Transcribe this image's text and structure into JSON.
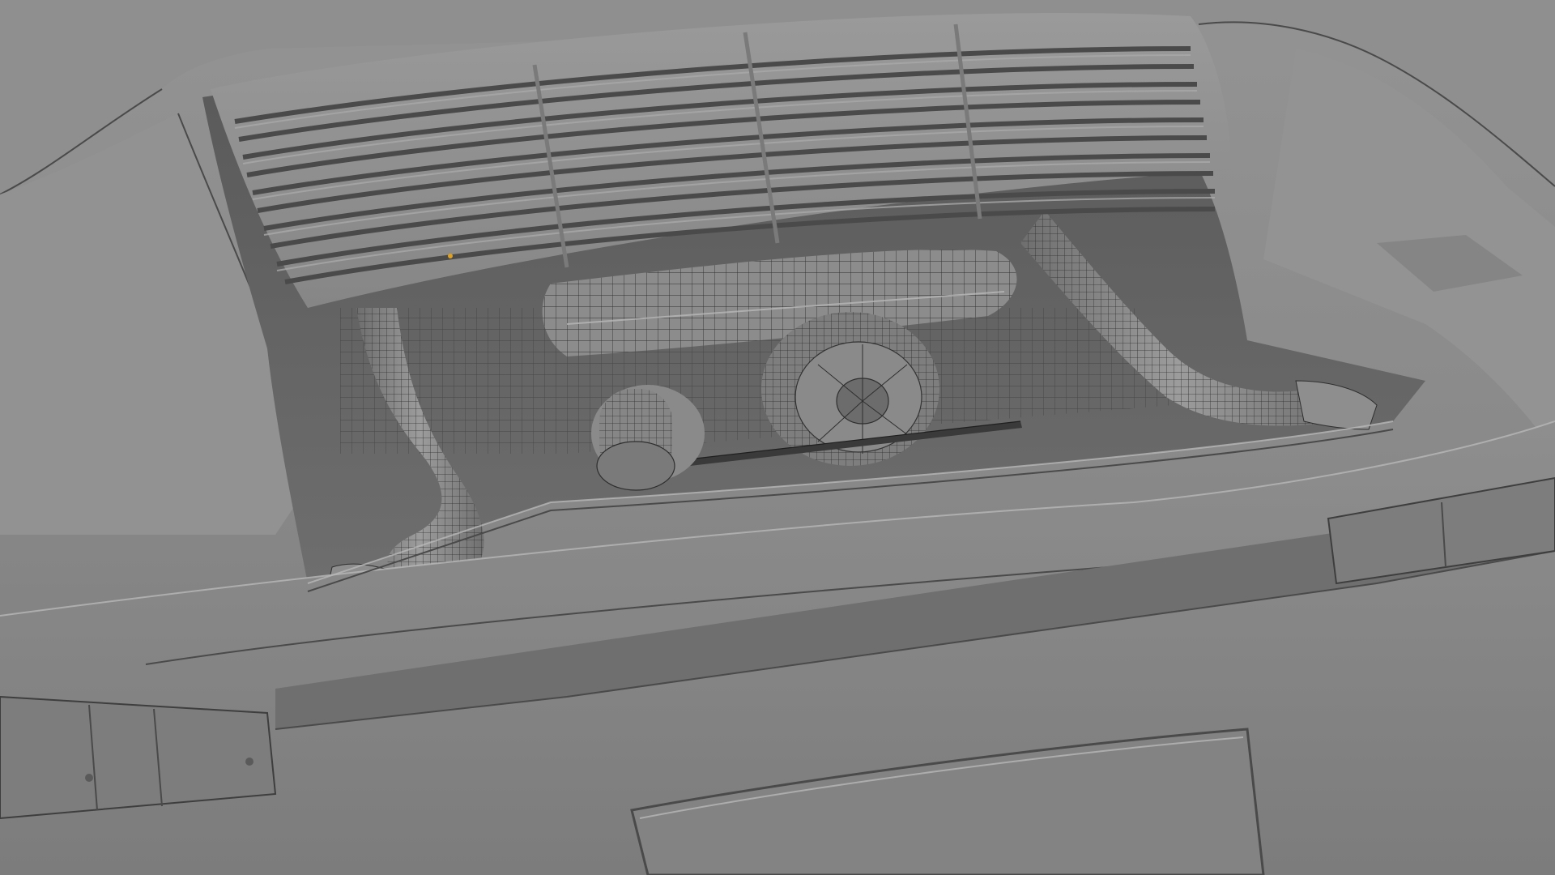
{
  "viewport": {
    "view_mode": "solid-shaded-with-wireframe-overlay",
    "background_color": "#6a6a6a",
    "body_color": "#8d8d8d",
    "highlight_color": "#a8a8a8",
    "shadow_color": "#4f4f4f",
    "wire_color": "#2e2e2e",
    "selected_vertex_color": "#e0a020"
  },
  "model": {
    "subject": "rear engine bay",
    "parts": [
      "engine-lid-grille",
      "intake-pipe-left",
      "intake-pipe-right",
      "alternator",
      "cooling-fan-pulley",
      "engine-crossbar",
      "rear-bumper",
      "license-plate-recess",
      "taillight-left",
      "taillight-right"
    ]
  }
}
